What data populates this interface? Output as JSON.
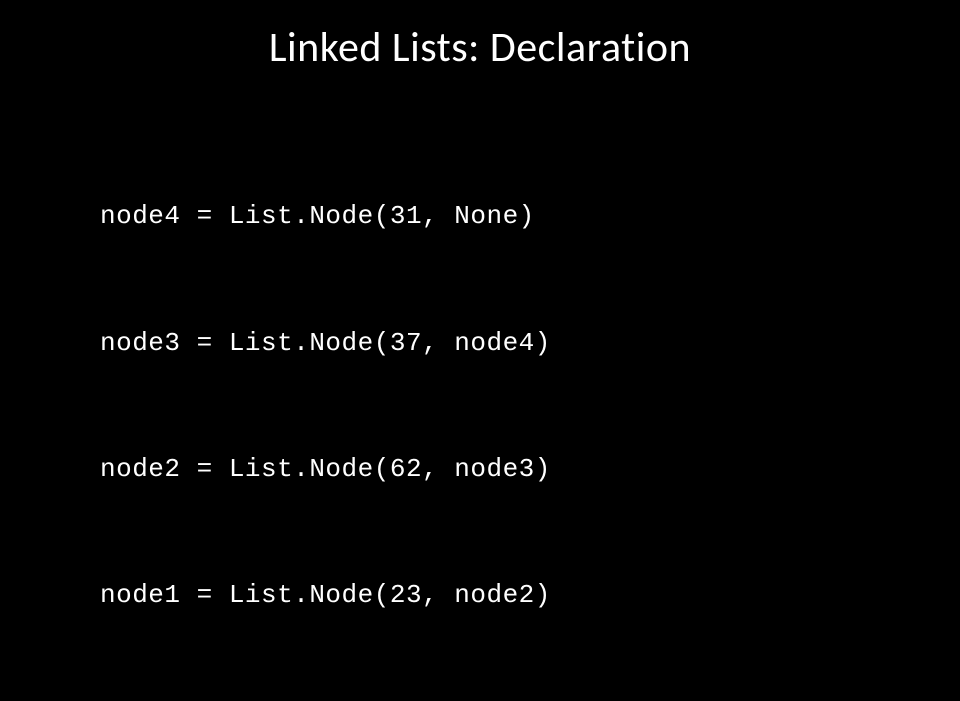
{
  "title": "Linked Lists: Declaration",
  "code": {
    "lines": [
      "node4 = List.Node(31, None)",
      "node3 = List.Node(37, node4)",
      "node2 = List.Node(62, node3)",
      "node1 = List.Node(23, node2)"
    ]
  }
}
